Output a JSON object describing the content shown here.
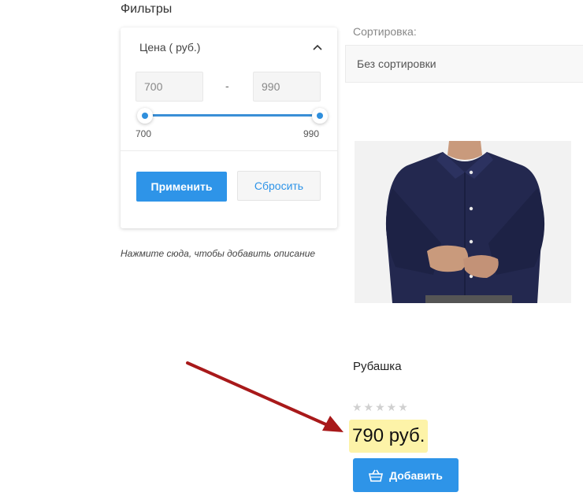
{
  "filters": {
    "title": "Фильтры",
    "price": {
      "header": "Цена ( руб.)",
      "min_value": "700",
      "max_value": "990",
      "range_separator": "-",
      "slider_min_label": "700",
      "slider_max_label": "990",
      "slider_low_fraction": 0,
      "slider_high_fraction": 1
    },
    "apply_label": "Применить",
    "reset_label": "Сбросить"
  },
  "description_hint": "Нажмите сюда, чтобы добавить описание",
  "sort": {
    "label": "Сортировка:",
    "selected": "Без сортировки"
  },
  "product": {
    "name": "Рубашка",
    "rating_stars": "★★★★★",
    "rating": 0,
    "price": "790 руб.",
    "add_label": "Добавить"
  },
  "colors": {
    "accent": "#2e94e8",
    "price_highlight": "#fdf3a8",
    "annotation_arrow": "#a8191a"
  }
}
